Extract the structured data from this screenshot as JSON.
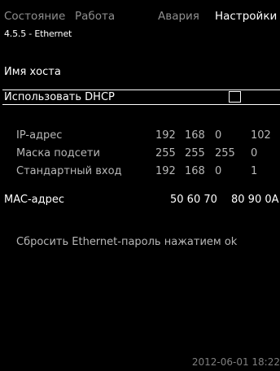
{
  "tabs": [
    {
      "label": "Состояние",
      "active": false
    },
    {
      "label": "Работа",
      "active": false
    },
    {
      "label": "Авария",
      "active": false
    },
    {
      "label": "Настройки",
      "active": true
    }
  ],
  "breadcrumb": "4.5.5 - Ethernet",
  "hostname_label": "Имя хоста",
  "dhcp": {
    "label": "Использовать DHCP",
    "checked": false
  },
  "network": {
    "ip": {
      "label": "IP-адрес",
      "octets": [
        "192",
        "168",
        "0",
        "102"
      ]
    },
    "mask": {
      "label": "Маска подсети",
      "octets": [
        "255",
        "255",
        "255",
        "0"
      ]
    },
    "gateway": {
      "label": "Стандартный вход",
      "octets": [
        "192",
        "168",
        "0",
        "1"
      ]
    }
  },
  "mac": {
    "label": "MAC-адрес",
    "parts": [
      "50 60 70",
      "80 90 0A"
    ]
  },
  "reset_text": "Сбросить Ethernet-пароль нажатием ok",
  "timestamp": "2012-06-01 18:22",
  "colors": {
    "background": "#000000",
    "text": "#ffffff",
    "inactive": "#8f8f8f"
  }
}
